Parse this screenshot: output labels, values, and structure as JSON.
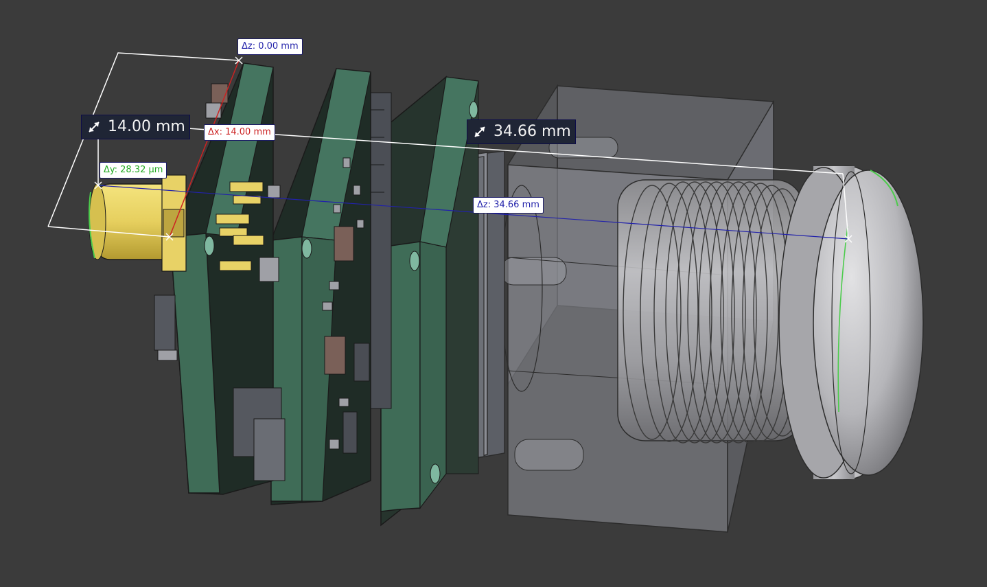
{
  "measurements": {
    "delta_z_top": {
      "label": "Δz: 0.00 mm",
      "color": "#2222aa"
    },
    "delta_x": {
      "label": "Δx: 14.00 mm",
      "color": "#cc2222"
    },
    "delta_y": {
      "label": "Δy: 28.32 µm",
      "color": "#22aa22"
    },
    "delta_z_mid": {
      "label": "Δz: 34.66 mm",
      "color": "#2222aa"
    },
    "distance_1": {
      "label": "14.00 mm",
      "icon": "diagonal-arrow-icon"
    },
    "distance_2": {
      "label": "34.66 mm",
      "icon": "diagonal-arrow-icon"
    }
  },
  "colors": {
    "background": "#3b3b3b",
    "pcb": "#2a3a32",
    "pcb_edge": "#3d6a55",
    "connector_gold": "#e8d266",
    "housing": "#8e9096",
    "lens_metal": "#c4c4c6",
    "measure_x": "#cc2222",
    "measure_y": "#22aa22",
    "measure_z": "#2222aa"
  }
}
